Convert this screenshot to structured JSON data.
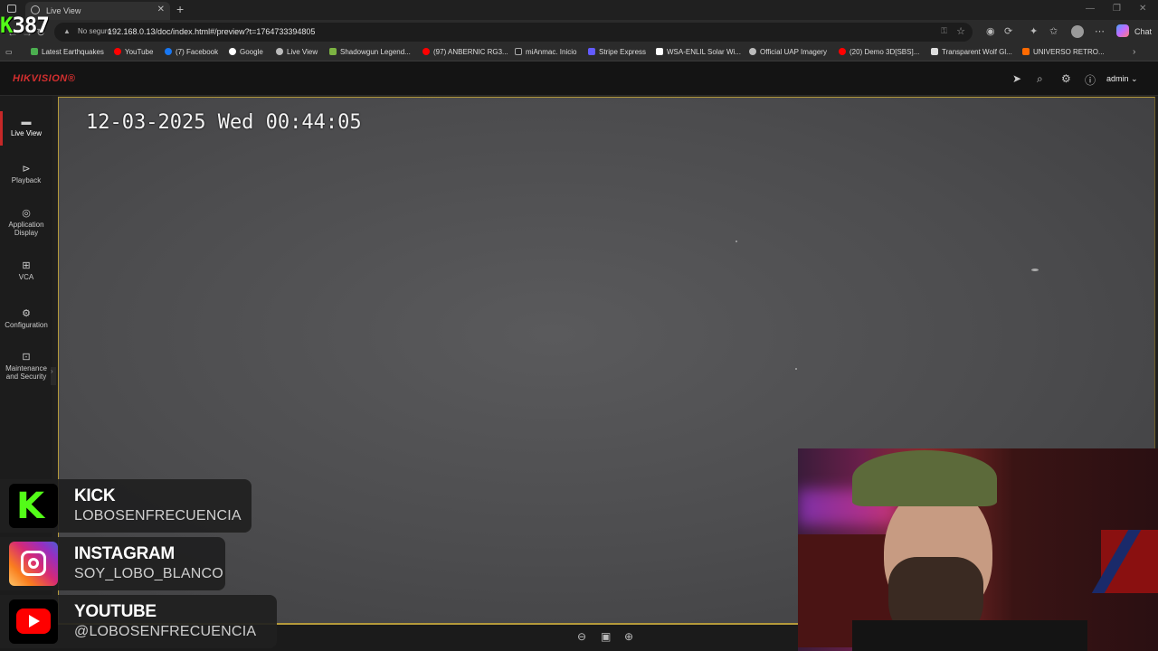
{
  "browser": {
    "tab_title": "Live View",
    "tab_close": "✕",
    "new_tab": "+",
    "address_security": "No seguro",
    "address_url": "192.168.0.13/doc/index.html#/preview?t=1764733394805",
    "chat_label": "Chat",
    "bookmarks": [
      {
        "label": "Latest Earthquakes",
        "color": "#4caf50"
      },
      {
        "label": "YouTube",
        "color": "#ff0000"
      },
      {
        "label": "(7) Facebook",
        "color": "#1877f2"
      },
      {
        "label": "Google",
        "color": "#ffffff"
      },
      {
        "label": "Live View",
        "color": "#bbbbbb"
      },
      {
        "label": "Shadowgun Legend...",
        "color": "#7cb342"
      },
      {
        "label": "(97) ANBERNIC RG3...",
        "color": "#ff0000"
      },
      {
        "label": "miAnmac. Inicio",
        "color": "#222222"
      },
      {
        "label": "Stripe Express",
        "color": "#635bff"
      },
      {
        "label": "WSA-ENLIL Solar Wi...",
        "color": "#ffffff"
      },
      {
        "label": "Official UAP Imagery",
        "color": "#bbbbbb"
      },
      {
        "label": "(20) Demo 3D[SBS]...",
        "color": "#ff0000"
      },
      {
        "label": "Transparent Wolf Gl...",
        "color": "#dddddd"
      },
      {
        "label": "UNIVERSO RETRO...",
        "color": "#ff6a00"
      }
    ]
  },
  "app": {
    "logo": "HIKVISION®",
    "user": "admin",
    "accent_color": "#c62828",
    "sidebar": [
      {
        "label": "Live View",
        "icon": "live-view-icon",
        "glyph": "▬"
      },
      {
        "label": "Playback",
        "icon": "playback-icon",
        "glyph": "▶"
      },
      {
        "label": "Application Display",
        "icon": "application-icon",
        "glyph": "◎"
      },
      {
        "label": "VCA",
        "icon": "vca-icon",
        "glyph": "⊞"
      },
      {
        "label": "Configuration",
        "icon": "gear-icon",
        "glyph": "⚙"
      },
      {
        "label": "Maintenance and Security",
        "icon": "maintenance-icon",
        "glyph": "⊡"
      }
    ]
  },
  "video": {
    "osd_timestamp": "12-03-2025 Wed 00:44:05"
  },
  "overlay": {
    "counter_badge": "387",
    "socials": [
      {
        "title": "KICK",
        "handle": "LOBOSENFRECUENCIA"
      },
      {
        "title": "INSTAGRAM",
        "handle": "SOY_LOBO_BLANCO"
      },
      {
        "title": "YOUTUBE",
        "handle": "@LOBOSENFRECUENCIA"
      }
    ]
  }
}
